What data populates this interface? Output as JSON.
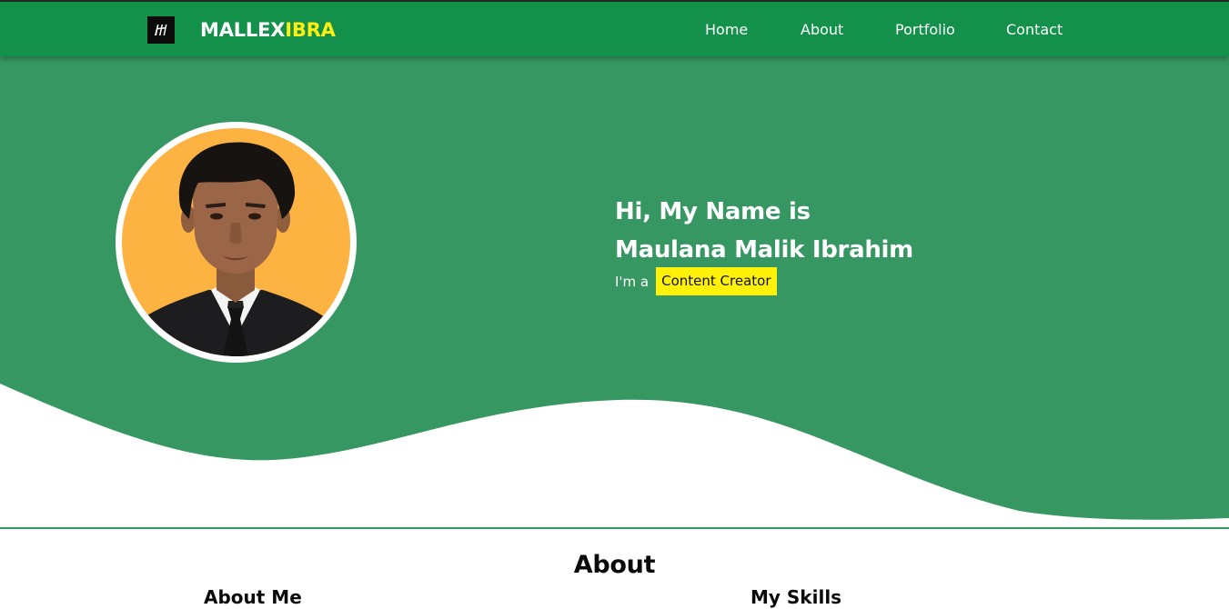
{
  "navbar": {
    "brand_main": "MALLEX",
    "brand_accent": "IBRA",
    "logo_icon": "mm-logo-icon",
    "links": [
      "Home",
      "About",
      "Portfolio",
      "Contact"
    ]
  },
  "hero": {
    "greeting_line1": "Hi, My Name is",
    "greeting_line2": "Maulana Malik Ibrahim",
    "role_prefix": "I'm a",
    "role_highlight": "Content Creator",
    "photo_icon": "profile-photo"
  },
  "about": {
    "title": "About",
    "left_heading": "About Me",
    "right_heading": "My Skills"
  },
  "colors": {
    "navbar_bg": "#13904a",
    "hero_bg": "#379762",
    "brand_accent": "#ffee14",
    "highlight_bg": "#fff10a",
    "photo_bg": "#fdb342"
  }
}
